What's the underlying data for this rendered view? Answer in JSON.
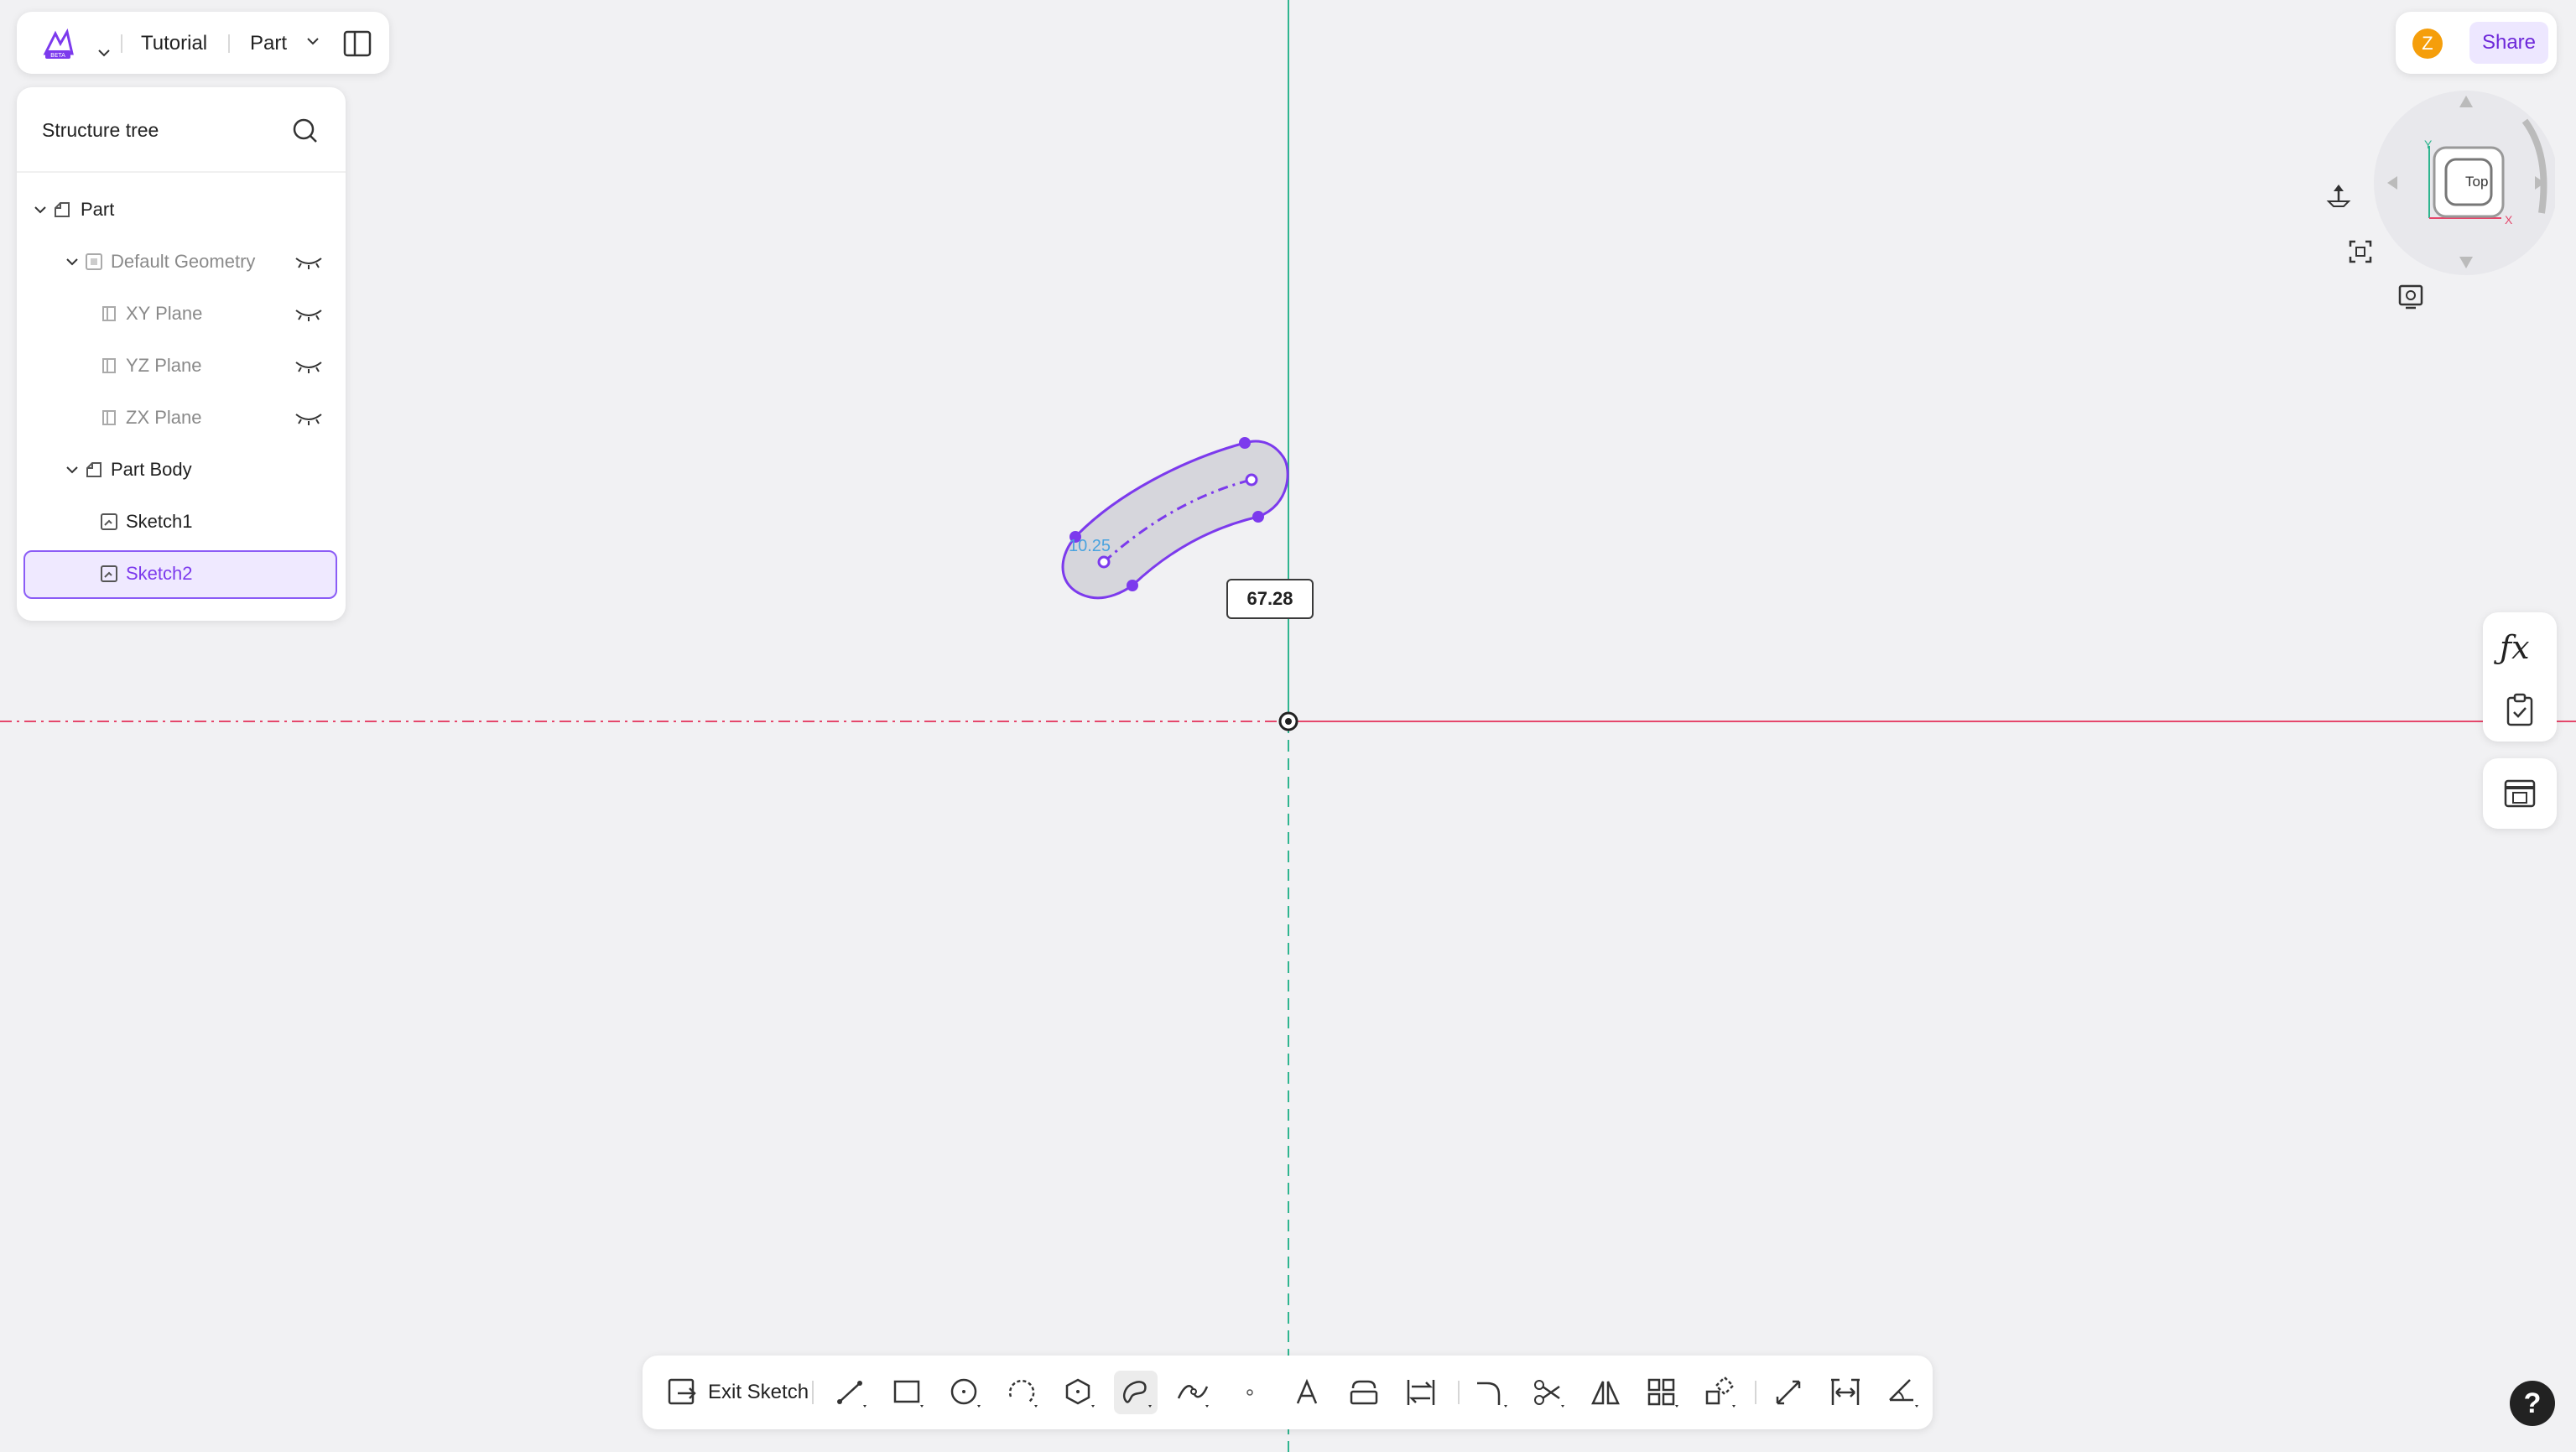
{
  "header": {
    "app_logo_icon": "app-beta-logo-icon",
    "document_title": "Tutorial",
    "mode_label": "Part"
  },
  "structure_tree": {
    "title": "Structure tree",
    "items": [
      {
        "label": "Part",
        "icon": "part-icon",
        "expanded": true,
        "level": 0
      },
      {
        "label": "Default Geometry",
        "icon": "geometry-icon",
        "expanded": true,
        "level": 1,
        "hidden": true
      },
      {
        "label": "XY Plane",
        "icon": "plane-icon",
        "level": 2,
        "hidden": true
      },
      {
        "label": "YZ Plane",
        "icon": "plane-icon",
        "level": 2,
        "hidden": true
      },
      {
        "label": "ZX Plane",
        "icon": "plane-icon",
        "level": 2,
        "hidden": true
      },
      {
        "label": "Part Body",
        "icon": "part-body-icon",
        "expanded": true,
        "level": 1
      },
      {
        "label": "Sketch1",
        "icon": "sketch-icon",
        "level": 2
      },
      {
        "label": "Sketch2",
        "icon": "sketch-icon",
        "level": 2,
        "selected": true
      }
    ]
  },
  "share": {
    "avatar_letter": "Z",
    "share_label": "Share"
  },
  "viewcube": {
    "face_label": "Top",
    "axis_x": "X",
    "axis_y": "Y"
  },
  "canvas": {
    "dimension_value": "67.28",
    "slot_width_label": "10.25"
  },
  "toolbar": {
    "exit_sketch_label": "Exit Sketch",
    "tools": [
      "line-tool",
      "rectangle-tool",
      "circle-tool",
      "arc-tool",
      "polygon-tool",
      "slot-tool",
      "spline-tool",
      "point-tool",
      "text-tool",
      "offset-tool",
      "project-tool",
      "fillet-tool",
      "trim-tool",
      "mirror-tool",
      "pattern-tool",
      "transform-tool",
      "dimension-tool",
      "constraint-tool",
      "angle-tool"
    ]
  },
  "colors": {
    "accent": "#7c3aed",
    "selection_bg": "#efe9ff",
    "x_axis": "#e5476b",
    "y_axis": "#2fb58f",
    "sketch_fill": "#d6d6dc"
  },
  "help_label": "?"
}
